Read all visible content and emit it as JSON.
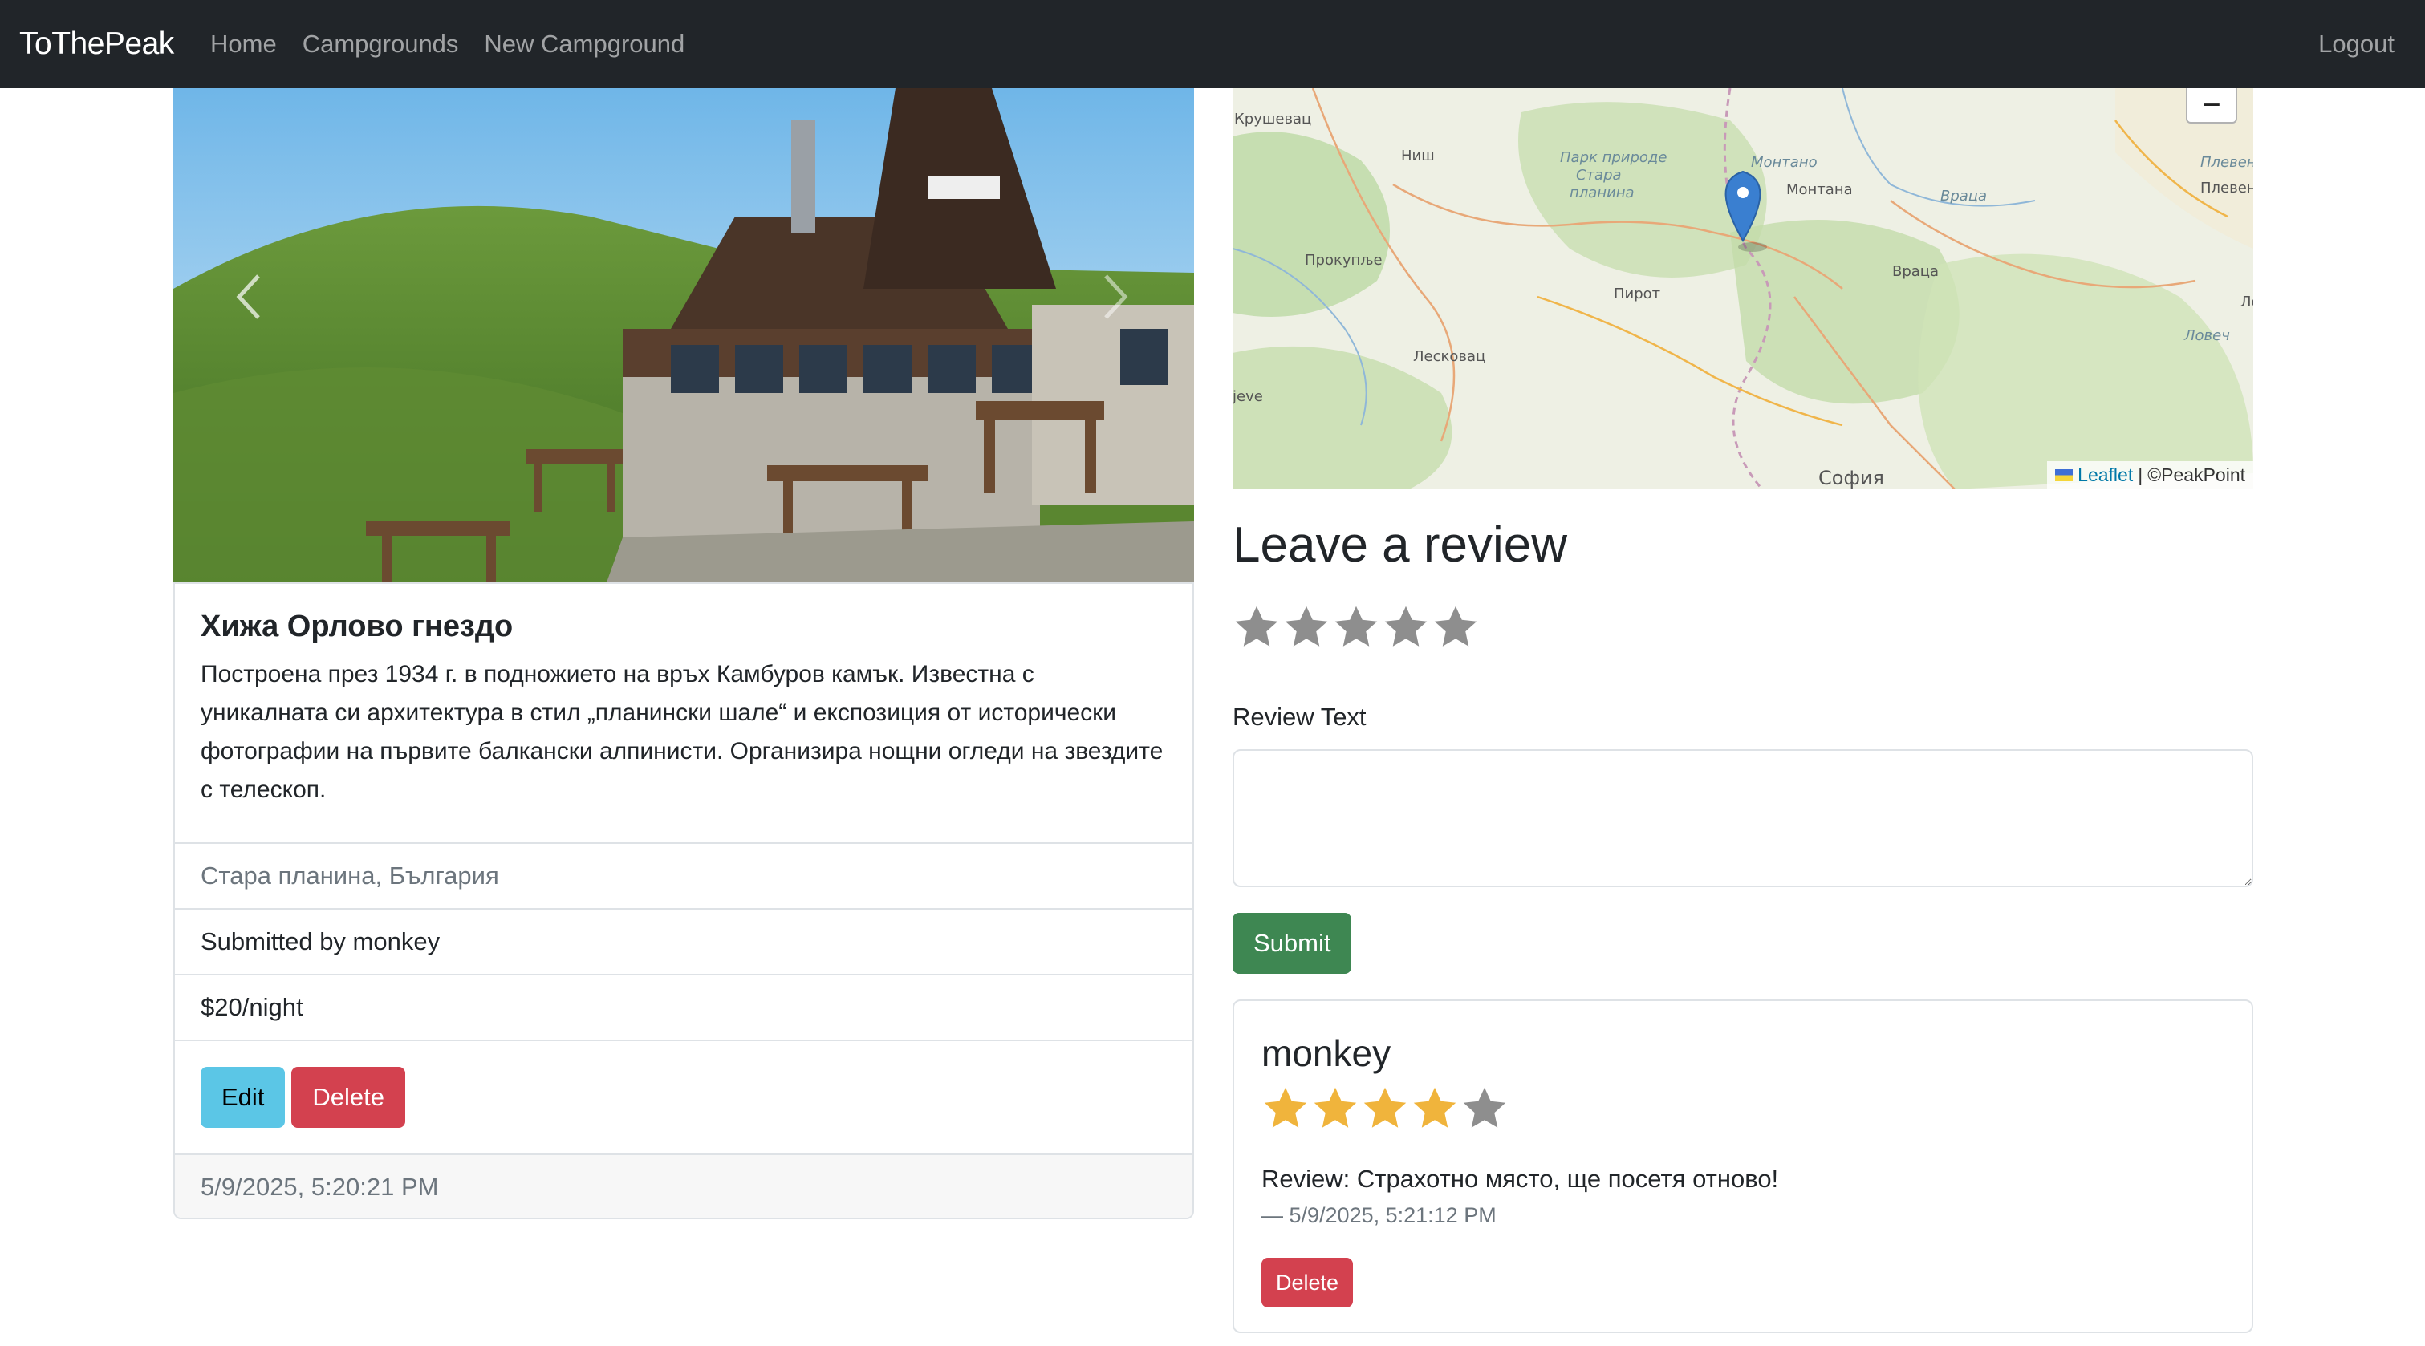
{
  "navbar": {
    "brand": "ToThePeak",
    "links": [
      "Home",
      "Campgrounds",
      "New Campground"
    ],
    "logout": "Logout"
  },
  "campground": {
    "title": "Хижа Орлово гнездо",
    "description": "Построена през 1934 г. в подножието на връх Камбуров камък. Известна с уникалната си архитектура в стил „планински шале“ и експозиция от исторически фотографии на първите балкански алпинисти. Организира нощни огледи на звездите с телескоп.",
    "location": "Стара планина, България",
    "submitted_by": "Submitted by monkey",
    "price": "$20/night",
    "edit_label": "Edit",
    "delete_label": "Delete",
    "timestamp": "5/9/2025, 5:20:21 PM"
  },
  "map": {
    "zoom_out": "−",
    "attribution_link": "Leaflet",
    "attribution_sep": "|",
    "attribution_text": "©PeakPoint",
    "labels": {
      "krushevac": "Крушевац",
      "park": "Парк природе",
      "stara": "Стара",
      "planina": "планина",
      "montana_it": "Монтано",
      "montana": "Монтана",
      "vraca_it": "Враца",
      "pleven1": "Плевен",
      "pleven2": "Плевен",
      "nis": "Ниш",
      "prokuplje": "Прокупље",
      "pirot": "Пирот",
      "vraca": "Враца",
      "lo": "Ло",
      "lovech": "Ловеч",
      "leskovac": "Лесковац",
      "jeve": "jeve",
      "sofia": "София"
    }
  },
  "review_form": {
    "heading": "Leave a review",
    "rating": 0,
    "max_rating": 5,
    "label": "Review Text",
    "textarea_value": "",
    "submit_label": "Submit"
  },
  "reviews": [
    {
      "author": "monkey",
      "rating": 4,
      "max_rating": 5,
      "text": "Review: Страхотно място, ще посетя отново!",
      "meta": "— 5/9/2025, 5:21:12 PM",
      "delete_label": "Delete"
    }
  ],
  "colors": {
    "navbar": "#212529",
    "star_filled": "#f0b43c",
    "star_empty": "#8e8e8e",
    "success": "#3e8752",
    "danger": "#d3414f",
    "info": "#5bc6e6"
  }
}
